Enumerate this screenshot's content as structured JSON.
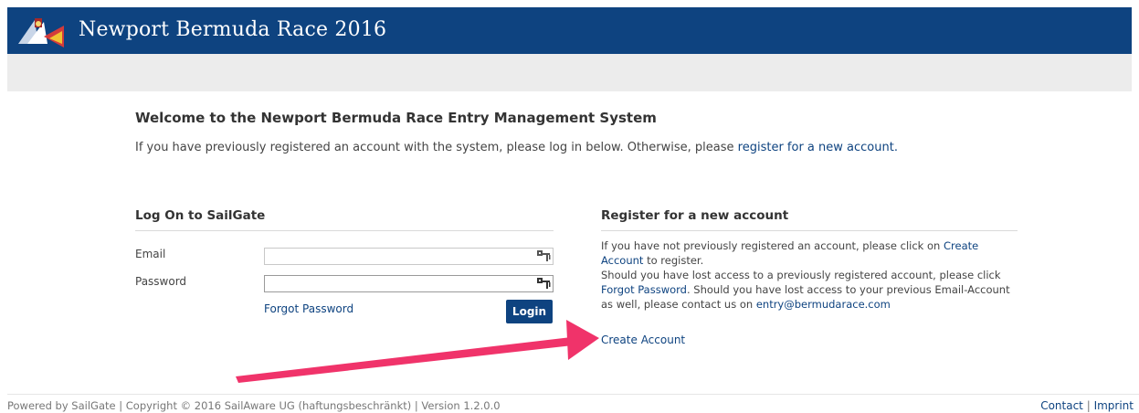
{
  "header": {
    "title": "Newport Bermuda Race 2016",
    "logo_icon": "burgee-flags-logo",
    "background_color": "#0e4380"
  },
  "welcome": {
    "heading": "Welcome to the Newport Bermuda Race Entry Management System",
    "intro_text": "If you have previously registered an account with the system, please log in below. Otherwise, please ",
    "intro_link": "register for a new account."
  },
  "login": {
    "title": "Log On to SailGate",
    "email_label": "Email",
    "email_value": "",
    "password_label": "Password",
    "password_value": "",
    "key_icon": "password-manager-key-icon",
    "forgot_label": "Forgot Password",
    "login_label": "Login"
  },
  "register": {
    "title": "Register for a new account",
    "p1_before": "If you have not previously registered an account, please click on ",
    "p1_link": "Create Account",
    "p1_after": " to register.",
    "p2_before": "Should you have lost access to a previously registered account, please click ",
    "p2_link": "Forgot Password",
    "p2_after": ". Should you have lost access to your previous Email-Account as well, please contact us on ",
    "email_link": "entry@bermudarace.com",
    "create_account_label": "Create Account"
  },
  "annotation": {
    "arrow_color": "#f0336a"
  },
  "footer": {
    "left_text": "Powered by SailGate | Copyright © 2016 SailAware UG (haftungsbeschränkt) | Version 1.2.0.0",
    "contact_label": "Contact",
    "separator": " | ",
    "imprint_label": "Imprint"
  }
}
